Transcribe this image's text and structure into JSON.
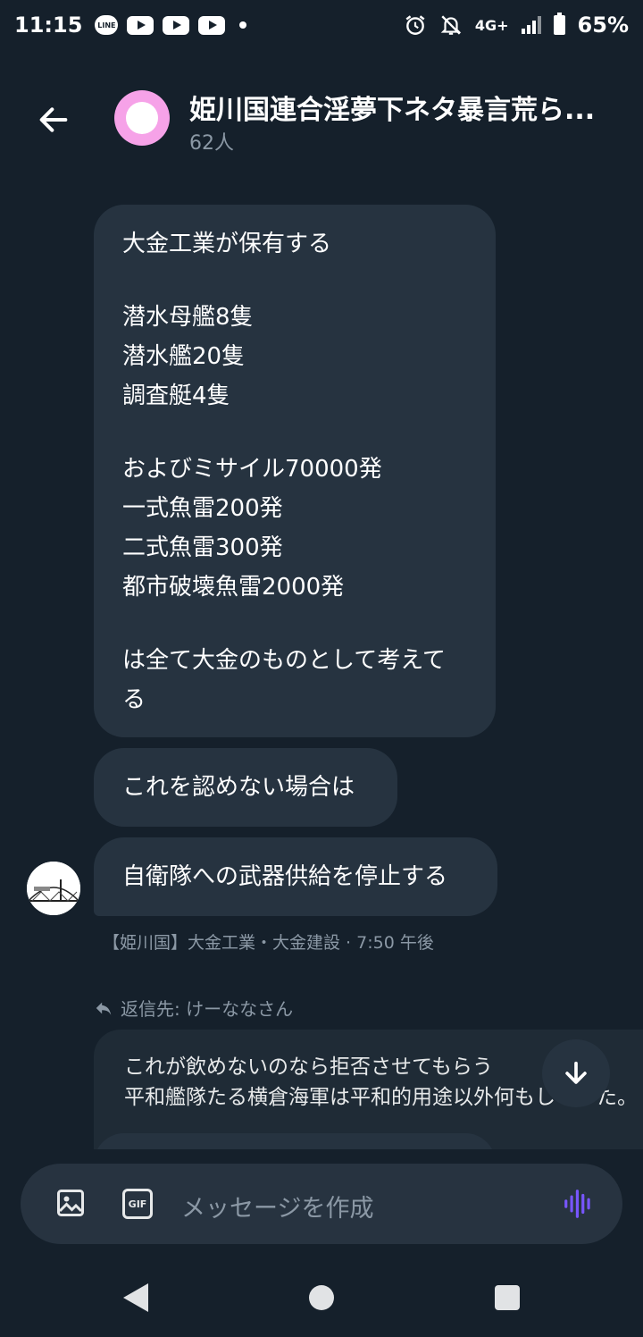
{
  "status_bar": {
    "time": "11:15",
    "network": "4G+",
    "battery": "65%",
    "icons": [
      "line-icon",
      "youtube-icon",
      "youtube-icon",
      "youtube-icon",
      "dot-icon",
      "alarm-icon",
      "mute-icon",
      "signal-icon",
      "battery-icon"
    ]
  },
  "header": {
    "title": "姫川国連合淫夢下ネタ暴言荒ら...",
    "members": "62人"
  },
  "messages": [
    {
      "lines": [
        "大金工業が保有する",
        "",
        "潜水母艦8隻",
        "潜水艦20隻",
        "調査艇4隻",
        "",
        "およびミサイル70000発",
        "一式魚雷200発",
        "二式魚雷300発",
        "都市破壊魚雷2000発",
        "",
        "は全て大金のものとして考えて",
        "る"
      ]
    },
    {
      "text": "これを認めない場合は"
    },
    {
      "text": "自衛隊への武器供給を停止する"
    }
  ],
  "sender_meta": "【姫川国】大金工業・大金建設 · 7:50 午後",
  "reply": {
    "reply_to": "返信先: けーななさん",
    "lines": [
      "これが飲めないのなら拒否させてもらう",
      "平和艦隊たる横倉海軍は平和的用途以外何もしないた。"
    ]
  },
  "composer": {
    "placeholder": "メッセージを作成"
  },
  "colors": {
    "background": "#15202b",
    "bubble": "#263340",
    "accent_voice": "#7856ff",
    "group_avatar": "#f6a2e8"
  }
}
